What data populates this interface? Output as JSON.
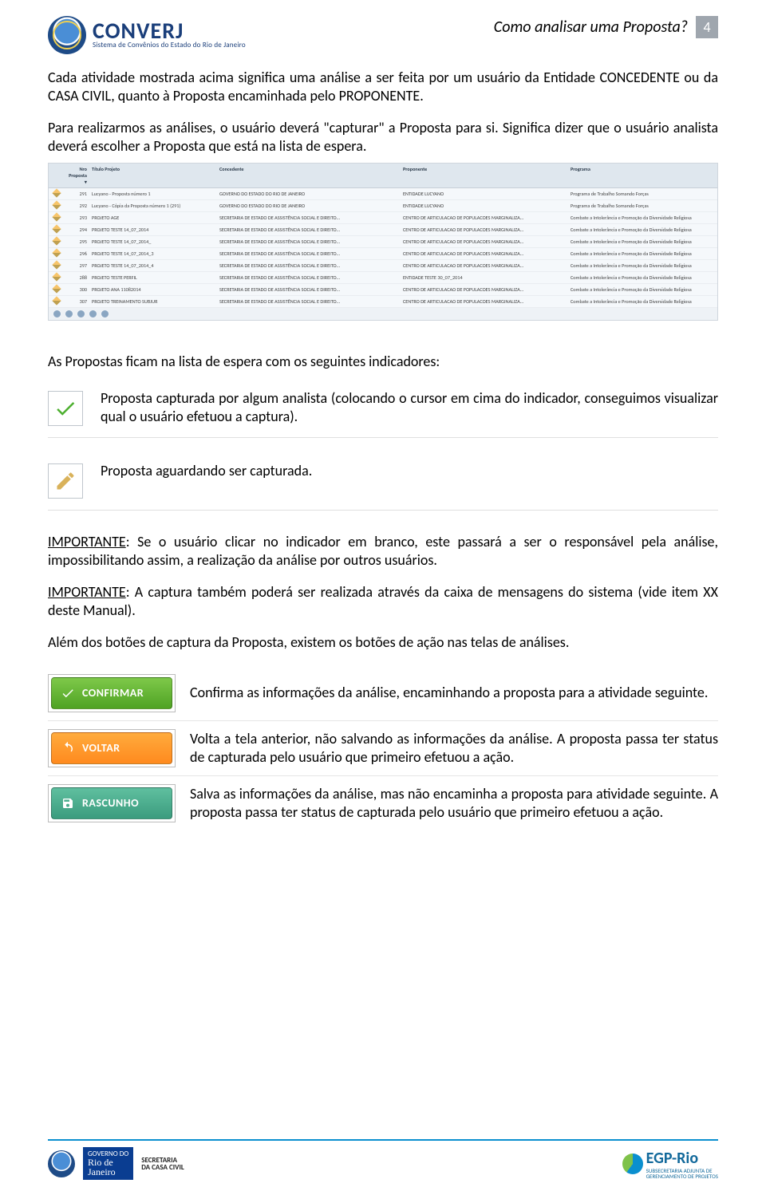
{
  "header": {
    "brand": "CONVERJ",
    "tagline": "Sistema de Convênios do Estado do Rio de Janeiro",
    "title": "Como analisar uma Proposta?",
    "page_number": "4"
  },
  "intro": {
    "p1": "Cada atividade mostrada acima significa uma análise a ser feita por um usuário da Entidade CONCEDENTE ou da CASA CIVIL, quanto à Proposta encaminhada pelo PROPONENTE.",
    "p2": "Para realizarmos as análises, o usuário deverá \"capturar\" a Proposta para si. Significa dizer que o usuário analista deverá escolher a Proposta que está na lista de espera."
  },
  "table": {
    "headers": {
      "nro": "Nro Proposta ▾",
      "titulo": "Título Projeto",
      "concedente": "Concedente",
      "proponente": "Proponente",
      "programa": "Programa"
    },
    "rows": [
      {
        "nro": "291",
        "titulo": "Lucyano - Proposta número 1",
        "concedente": "GOVERNO DO ESTADO DO RIO DE JANEIRO",
        "proponente": "ENTIDADE LUCYANO",
        "programa": "Programa de Trabalho Somando Forças"
      },
      {
        "nro": "292",
        "titulo": "Lucyano - Cópia da Proposta número 1 (291)",
        "concedente": "GOVERNO DO ESTADO DO RIO DE JANEIRO",
        "proponente": "ENTIDADE LUCYANO",
        "programa": "Programa de Trabalho Somando Forças"
      },
      {
        "nro": "293",
        "titulo": "PROJETO AGE",
        "concedente": "SECRETARIA DE ESTADO DE ASSISTÊNCIA SOCIAL E DIREITO...",
        "proponente": "CENTRO DE ARTICULACAO DE POPULACOES MARGINALIZA...",
        "programa": "Combate a Intolerância e Promoção da Diversidade Religiosa"
      },
      {
        "nro": "294",
        "titulo": "PROJETO TESTE 14_07_2014",
        "concedente": "SECRETARIA DE ESTADO DE ASSISTÊNCIA SOCIAL E DIREITO...",
        "proponente": "CENTRO DE ARTICULACAO DE POPULACOES MARGINALIZA...",
        "programa": "Combate a Intolerância e Promoção da Diversidade Religiosa"
      },
      {
        "nro": "295",
        "titulo": "PROJETO TESTE 14_07_2014_",
        "concedente": "SECRETARIA DE ESTADO DE ASSISTÊNCIA SOCIAL E DIREITO...",
        "proponente": "CENTRO DE ARTICULACAO DE POPULACOES MARGINALIZA...",
        "programa": "Combate a Intolerância e Promoção da Diversidade Religiosa"
      },
      {
        "nro": "296",
        "titulo": "PROJETO TESTE 14_07_2014_3",
        "concedente": "SECRETARIA DE ESTADO DE ASSISTÊNCIA SOCIAL E DIREITO...",
        "proponente": "CENTRO DE ARTICULACAO DE POPULACOES MARGINALIZA...",
        "programa": "Combate a Intolerância e Promoção da Diversidade Religiosa"
      },
      {
        "nro": "297",
        "titulo": "PROJETO TESTE 14_07_2014_4",
        "concedente": "SECRETARIA DE ESTADO DE ASSISTÊNCIA SOCIAL E DIREITO...",
        "proponente": "CENTRO DE ARTICULACAO DE POPULACOES MARGINALIZA...",
        "programa": "Combate a Intolerância e Promoção da Diversidade Religiosa"
      },
      {
        "nro": "288",
        "titulo": "PROJETO TESTE PERFIL",
        "concedente": "SECRETARIA DE ESTADO DE ASSISTÊNCIA SOCIAL E DIREITO...",
        "proponente": "ENTIDADE TESTE 30_07_2014",
        "programa": "Combate a Intolerância e Promoção da Diversidade Religiosa"
      },
      {
        "nro": "300",
        "titulo": "PROJETO ANA 11082014",
        "concedente": "SECRETARIA DE ESTADO DE ASSISTÊNCIA SOCIAL E DIREITO...",
        "proponente": "CENTRO DE ARTICULACAO DE POPULACOES MARGINALIZA...",
        "programa": "Combate a Intolerância e Promoção da Diversidade Religiosa"
      },
      {
        "nro": "307",
        "titulo": "PROJETO TREINAMENTO SUBJUR",
        "concedente": "SECRETARIA DE ESTADO DE ASSISTÊNCIA SOCIAL E DIREITO...",
        "proponente": "CENTRO DE ARTICULACAO DE POPULACOES MARGINALIZA...",
        "programa": "Combate a Intolerância e Promoção da Diversidade Religiosa"
      }
    ]
  },
  "indicators": {
    "heading": "As Propostas ficam na lista de espera com os seguintes indicadores:",
    "captured": "Proposta capturada por algum analista (colocando o cursor em cima do indicador, conseguimos visualizar qual o usuário efetuou a captura).",
    "pending": "Proposta aguardando ser capturada."
  },
  "important": {
    "label": "IMPORTANTE",
    "p1": ": Se o usuário clicar no indicador em branco, este passará a ser o responsável pela análise, impossibilitando assim, a realização da análise por outros usuários.",
    "p2": ": A captura também poderá ser realizada através da caixa de mensagens do sistema (vide item XX deste Manual).",
    "p3": "Além dos botões de captura da Proposta, existem os botões de ação nas telas de análises."
  },
  "actions": {
    "confirm": {
      "label": "CONFIRMAR",
      "text": "Confirma as informações da análise, encaminhando a proposta para a atividade seguinte."
    },
    "back": {
      "label": "VOLTAR",
      "text": "Volta a tela anterior, não salvando as informações da análise. A proposta passa ter status de capturada pelo usuário que primeiro efetuou a ação."
    },
    "draft": {
      "label": "RASCUNHO",
      "text": "Salva as informações da análise, mas não encaminha a proposta para atividade seguinte. A proposta passa ter status de capturada pelo usuário que primeiro efetuou a ação."
    }
  },
  "footer": {
    "gov_line1": "GOVERNO DO",
    "gov_line2": "Rio de",
    "gov_line3": "Janeiro",
    "casa1": "SECRETARIA",
    "casa2": "DA CASA CIVIL",
    "egp": "EGP-Rio",
    "egp_sub1": "SUBSECRETARIA ADJUNTA DE",
    "egp_sub2": "GERENCIAMENTO DE PROJETOS"
  }
}
